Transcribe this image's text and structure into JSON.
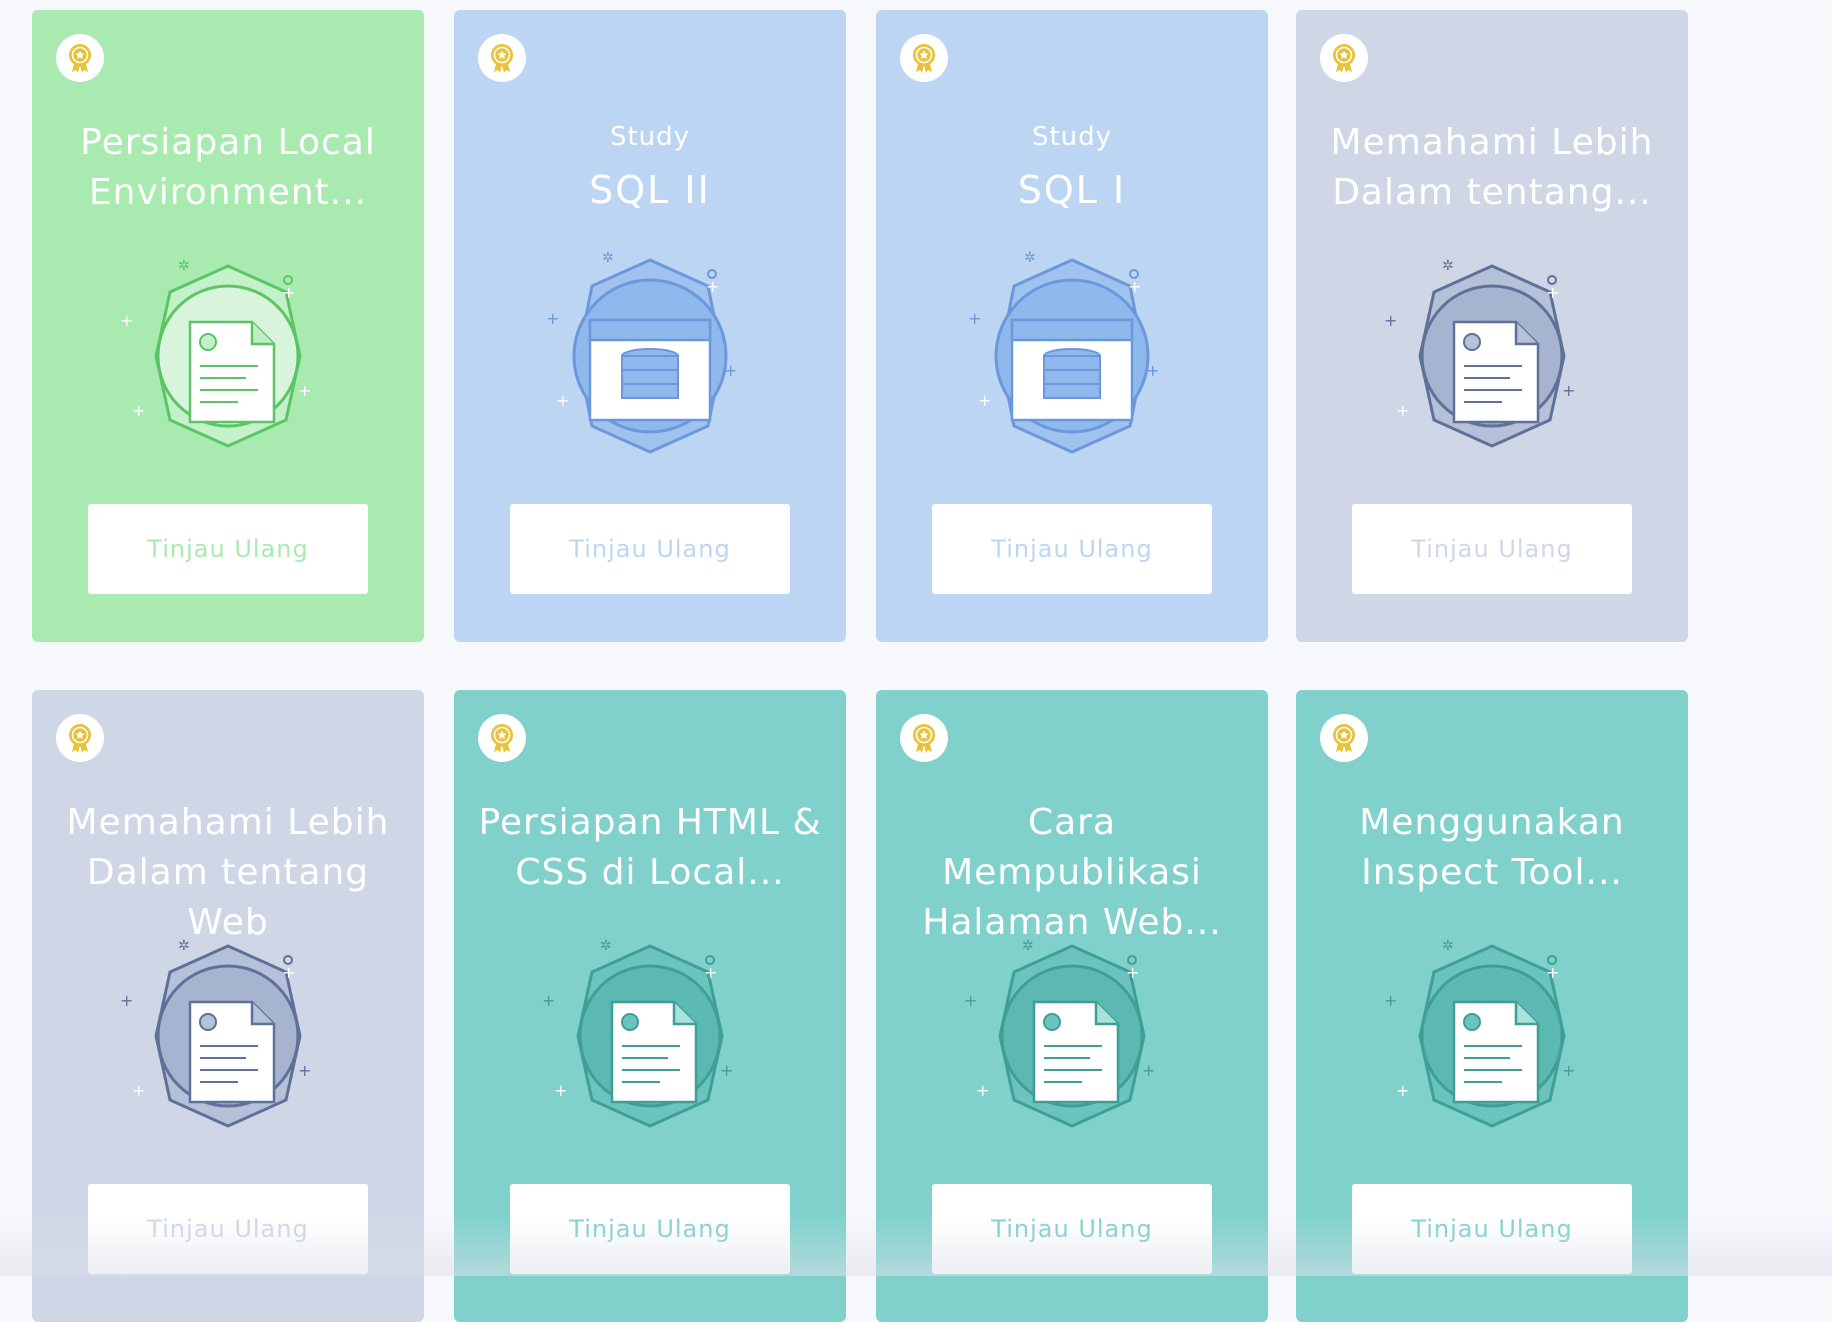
{
  "colors": {
    "green": "#a8eab0",
    "blue": "#bcd5f2",
    "gray": "#cfd7e6",
    "teal": "#80d1cc",
    "medal": "#e8c23a"
  },
  "cards": [
    {
      "title": "Persiapan Local Environment...",
      "button": "Tinjau Ulang",
      "icon": "document-badge-icon",
      "theme": "green"
    },
    {
      "eyebrow": "Study",
      "title": "SQL II",
      "button": "Tinjau Ulang",
      "icon": "database-badge-icon",
      "theme": "blue"
    },
    {
      "eyebrow": "Study",
      "title": "SQL I",
      "button": "Tinjau Ulang",
      "icon": "database-badge-icon",
      "theme": "blue"
    },
    {
      "title": "Memahami Lebih Dalam tentang...",
      "button": "Tinjau Ulang",
      "icon": "document-badge-icon",
      "theme": "gray"
    },
    {
      "title": "Memahami Lebih Dalam tentang Web",
      "button": "Tinjau Ulang",
      "icon": "document-badge-icon",
      "theme": "gray"
    },
    {
      "title": "Persiapan HTML & CSS di Local...",
      "button": "Tinjau Ulang",
      "icon": "document-badge-icon",
      "theme": "teal"
    },
    {
      "title": "Cara Mempublikasi Halaman Web...",
      "button": "Tinjau Ulang",
      "icon": "document-badge-icon",
      "theme": "teal"
    },
    {
      "title": "Menggunakan Inspect Tool...",
      "button": "Tinjau Ulang",
      "icon": "document-badge-icon",
      "theme": "teal"
    }
  ]
}
